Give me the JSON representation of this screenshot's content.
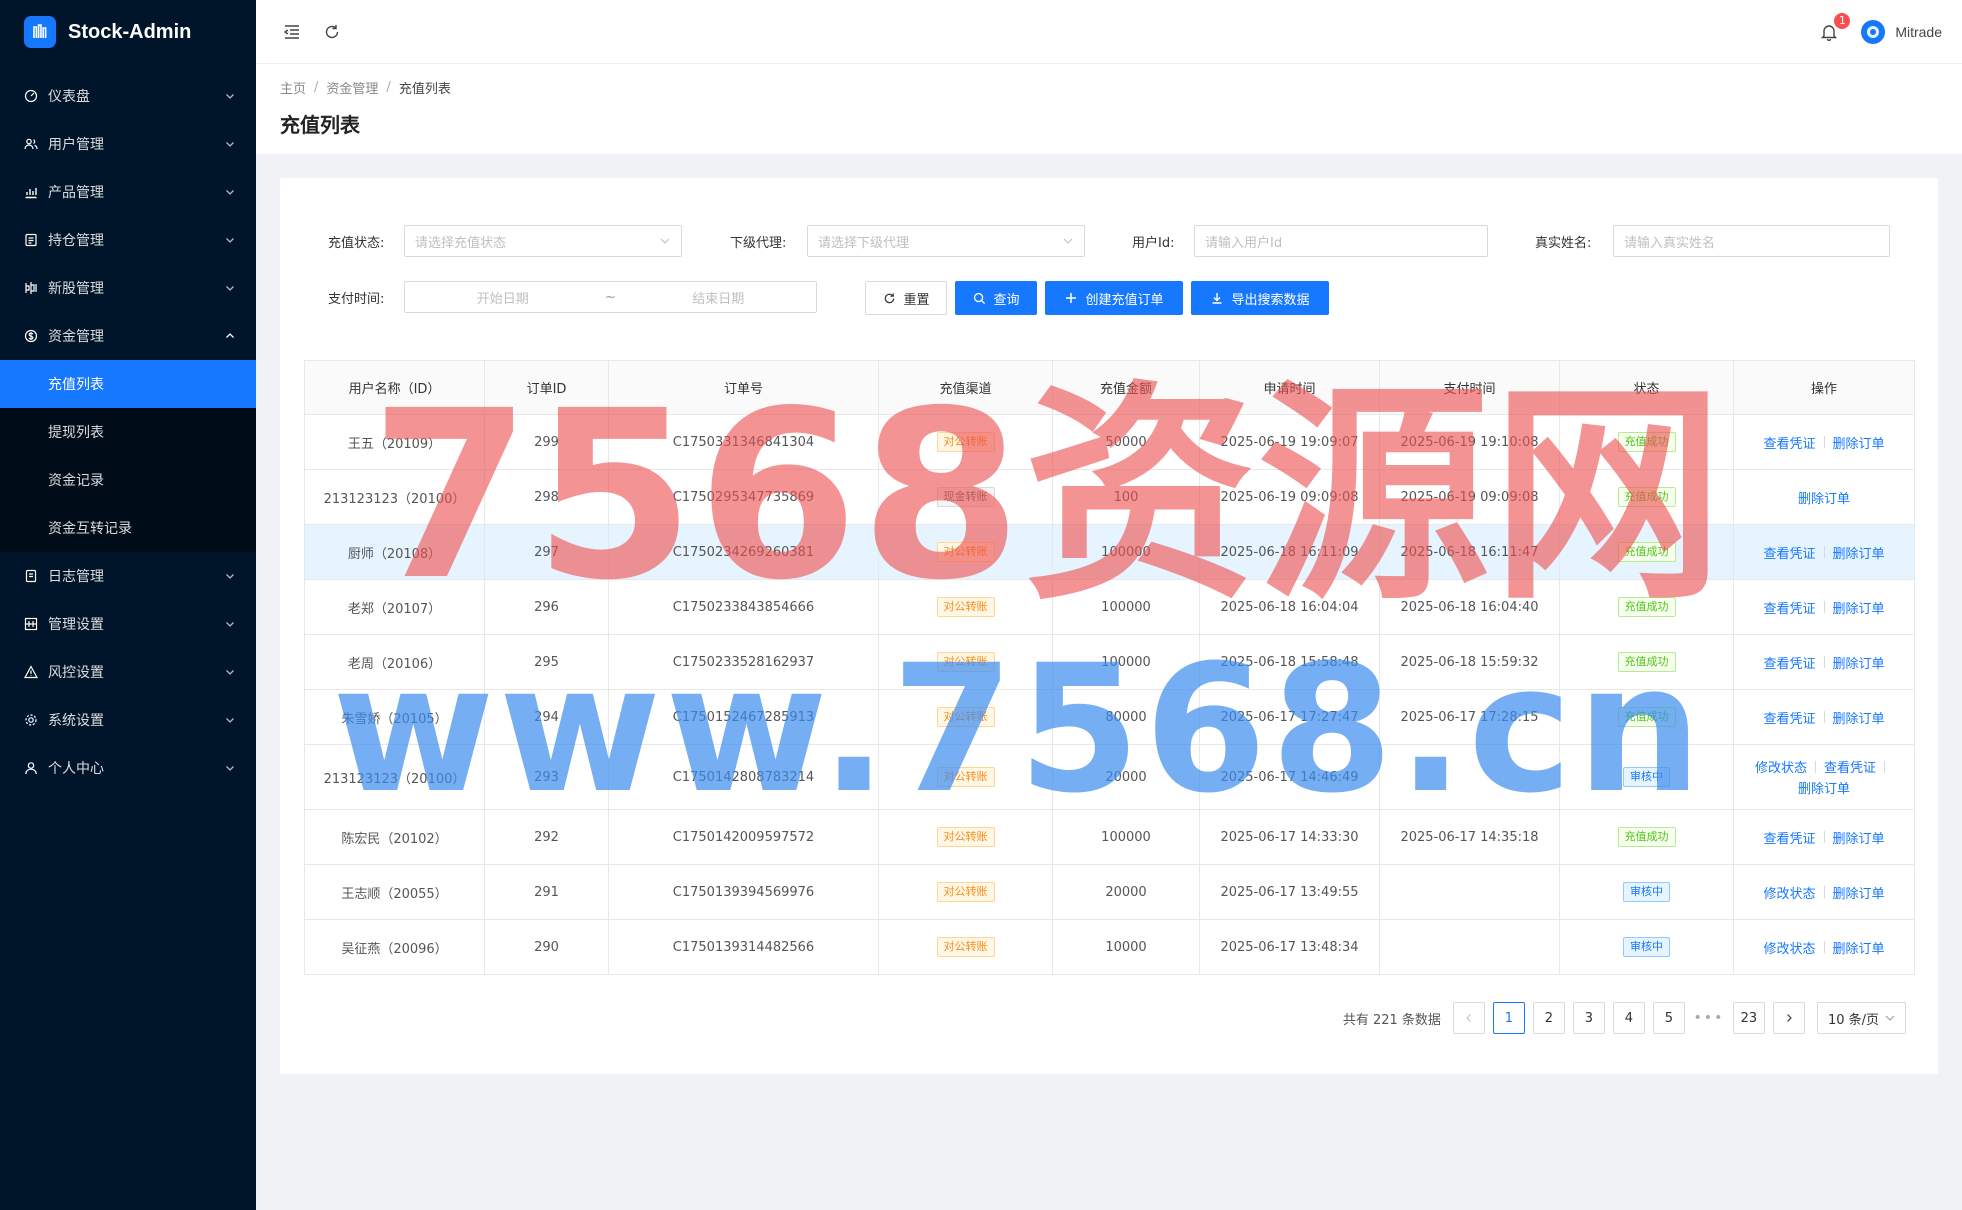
{
  "app": {
    "title": "Stock-Admin"
  },
  "sidebar": {
    "items": [
      {
        "label": "仪表盘",
        "icon": "dashboard-icon"
      },
      {
        "label": "用户管理",
        "icon": "users-icon"
      },
      {
        "label": "产品管理",
        "icon": "chart-icon"
      },
      {
        "label": "持仓管理",
        "icon": "position-icon"
      },
      {
        "label": "新股管理",
        "icon": "stock-icon"
      },
      {
        "label": "资金管理",
        "icon": "money-icon"
      }
    ],
    "sub_items": [
      "充值列表",
      "提现列表",
      "资金记录",
      "资金互转记录"
    ],
    "items_after": [
      {
        "label": "日志管理",
        "icon": "log-icon"
      },
      {
        "label": "管理设置",
        "icon": "admin-icon"
      },
      {
        "label": "风控设置",
        "icon": "warning-icon"
      },
      {
        "label": "系统设置",
        "icon": "gear-icon"
      },
      {
        "label": "个人中心",
        "icon": "user-icon"
      }
    ]
  },
  "header": {
    "notification_count": "1",
    "username": "Mitrade"
  },
  "breadcrumb": [
    "主页",
    "资金管理",
    "充值列表"
  ],
  "page": {
    "title": "充值列表"
  },
  "filters": {
    "status_label": "充值状态:",
    "status_placeholder": "请选择充值状态",
    "agent_label": "下级代理:",
    "agent_placeholder": "请选择下级代理",
    "userid_label": "用户Id:",
    "userid_placeholder": "请输入用户Id",
    "realname_label": "真实姓名:",
    "realname_placeholder": "请输入真实姓名",
    "paytime_label": "支付时间:",
    "start_placeholder": "开始日期",
    "range_sep": "~",
    "end_placeholder": "结束日期",
    "reset": "重置",
    "search": "查询",
    "create": "创建充值订单",
    "export": "导出搜索数据"
  },
  "table": {
    "columns": [
      "用户名称（ID）",
      "订单ID",
      "订单号",
      "充值渠道",
      "充值金额",
      "申请时间",
      "支付时间",
      "状态",
      "操作"
    ],
    "rows": [
      {
        "user": "王五（20109）",
        "id": "299",
        "order": "C1750331346841304",
        "channel": "对公转账",
        "ch": "orange",
        "amount": "50000",
        "apply": "2025-06-19 19:09:07",
        "pay": "2025-06-19 19:10:08",
        "status": "充值成功",
        "st": "green",
        "ops": [
          "查看凭证",
          "删除订单"
        ]
      },
      {
        "user": "213123123（20100）",
        "id": "298",
        "order": "C1750295347735869",
        "channel": "现金转账",
        "ch": "gray",
        "amount": "100",
        "apply": "2025-06-19 09:09:08",
        "pay": "2025-06-19 09:09:08",
        "status": "充值成功",
        "st": "green",
        "ops": [
          "删除订单"
        ]
      },
      {
        "user": "厨师（20108）",
        "id": "297",
        "order": "C1750234269260381",
        "channel": "对公转账",
        "ch": "orange",
        "amount": "100000",
        "apply": "2025-06-18 16:11:09",
        "pay": "2025-06-18 16:11:47",
        "status": "充值成功",
        "st": "green",
        "ops": [
          "查看凭证",
          "删除订单"
        ]
      },
      {
        "user": "老郑（20107）",
        "id": "296",
        "order": "C1750233843854666",
        "channel": "对公转账",
        "ch": "orange",
        "amount": "100000",
        "apply": "2025-06-18 16:04:04",
        "pay": "2025-06-18 16:04:40",
        "status": "充值成功",
        "st": "green",
        "ops": [
          "查看凭证",
          "删除订单"
        ]
      },
      {
        "user": "老周（20106）",
        "id": "295",
        "order": "C1750233528162937",
        "channel": "对公转账",
        "ch": "orange",
        "amount": "100000",
        "apply": "2025-06-18 15:58:48",
        "pay": "2025-06-18 15:59:32",
        "status": "充值成功",
        "st": "green",
        "ops": [
          "查看凭证",
          "删除订单"
        ]
      },
      {
        "user": "朱雪娇（20105）",
        "id": "294",
        "order": "C1750152467285913",
        "channel": "对公转账",
        "ch": "orange",
        "amount": "80000",
        "apply": "2025-06-17 17:27:47",
        "pay": "2025-06-17 17:28:15",
        "status": "充值成功",
        "st": "green",
        "ops": [
          "查看凭证",
          "删除订单"
        ]
      },
      {
        "user": "213123123（20100）",
        "id": "293",
        "order": "C1750142808783214",
        "channel": "对公转账",
        "ch": "orange",
        "amount": "20000",
        "apply": "2025-06-17 14:46:49",
        "pay": "",
        "status": "审核中",
        "st": "blue",
        "ops": [
          "修改状态",
          "查看凭证",
          "删除订单"
        ]
      },
      {
        "user": "陈宏民（20102）",
        "id": "292",
        "order": "C1750142009597572",
        "channel": "对公转账",
        "ch": "orange",
        "amount": "100000",
        "apply": "2025-06-17 14:33:30",
        "pay": "2025-06-17 14:35:18",
        "status": "充值成功",
        "st": "green",
        "ops": [
          "查看凭证",
          "删除订单"
        ]
      },
      {
        "user": "王志顺（20055）",
        "id": "291",
        "order": "C1750139394569976",
        "channel": "对公转账",
        "ch": "orange",
        "amount": "20000",
        "apply": "2025-06-17 13:49:55",
        "pay": "",
        "status": "审核中",
        "st": "blue",
        "ops": [
          "修改状态",
          "删除订单"
        ]
      },
      {
        "user": "吴征燕（20096）",
        "id": "290",
        "order": "C1750139314482566",
        "channel": "对公转账",
        "ch": "orange",
        "amount": "10000",
        "apply": "2025-06-17 13:48:34",
        "pay": "",
        "status": "审核中",
        "st": "blue",
        "ops": [
          "修改状态",
          "删除订单"
        ]
      }
    ]
  },
  "pagination": {
    "total": "共有 221 条数据",
    "pages": [
      "1",
      "2",
      "3",
      "4",
      "5"
    ],
    "dots": "•••",
    "last": "23",
    "size": "10 条/页"
  },
  "watermark": {
    "line1": "7568资源网",
    "line2": "www.7568.cn"
  },
  "colors": {
    "primary": "#1677ff",
    "sidebar": "#001529",
    "submenu": "#000c17"
  }
}
